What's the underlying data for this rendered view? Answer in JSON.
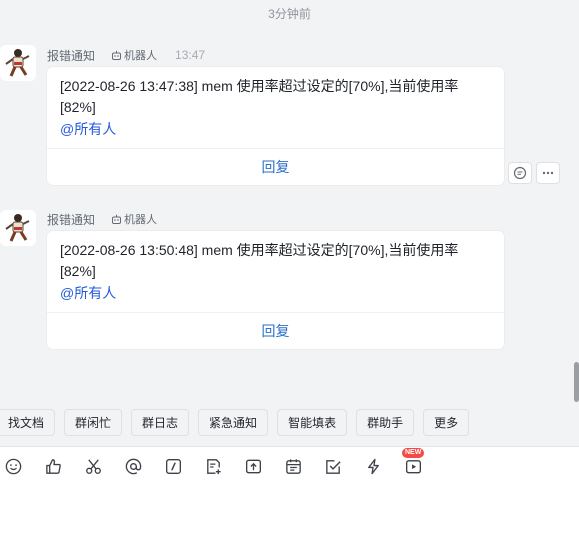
{
  "time_separator": "3分钟前",
  "messages": [
    {
      "sender": "报错通知",
      "tag": "机器人",
      "time": "13:47",
      "text": "[2022-08-26 13:47:38] mem 使用率超过设定的[70%],当前使用率\n[82%]",
      "mention": "@所有人",
      "reply_label": "回复"
    },
    {
      "sender": "报错通知",
      "tag": "机器人",
      "time": "",
      "text": "[2022-08-26 13:50:48] mem 使用率超过设定的[70%],当前使用率\n[82%]",
      "mention": "@所有人",
      "reply_label": "回复"
    }
  ],
  "hover_actions": [
    "reply-thread-icon",
    "more-icon"
  ],
  "quick_actions": [
    "找文档",
    "群闲忙",
    "群日志",
    "紧急通知",
    "智能填表",
    "群助手",
    "更多"
  ],
  "toolbar": {
    "icons": [
      "emoji-icon",
      "thumbs-up-icon",
      "scissors-icon",
      "at-icon",
      "slash-command-icon",
      "doc-add-icon",
      "upload-icon",
      "calendar-icon",
      "task-check-icon",
      "lightning-icon",
      "video-icon"
    ],
    "new_badge": "NEW"
  },
  "colors": {
    "background": "#f2f3f5",
    "card": "#ffffff",
    "mention": "#245bdb",
    "reply": "#2b6ec8",
    "badge": "#f54a45"
  }
}
